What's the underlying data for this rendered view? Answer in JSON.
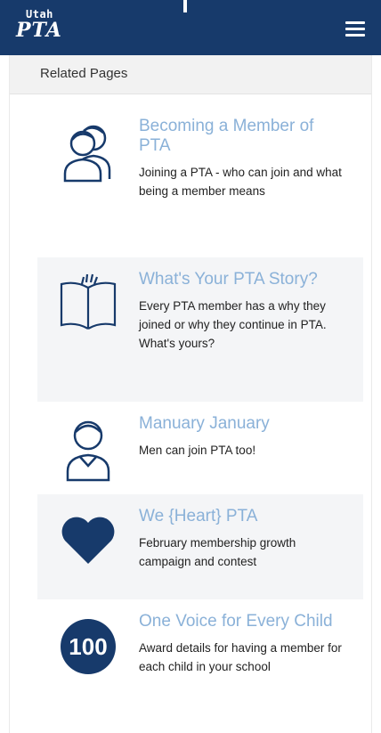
{
  "header": {
    "logo_top": "Utah",
    "logo_main": "PTA",
    "menu_icon": "hamburger-menu-icon"
  },
  "section": {
    "title": "Related Pages"
  },
  "items": [
    {
      "icon": "two-people-icon",
      "title": "Becoming a Member of PTA",
      "desc": "Joining a PTA - who can join and what being a member means"
    },
    {
      "icon": "open-book-icon",
      "title": "What's Your PTA Story?",
      "desc": "Every PTA member has a why they joined or why they continue in PTA. What's yours?"
    },
    {
      "icon": "person-icon",
      "title": "Manuary January",
      "desc": "Men can join PTA too!"
    },
    {
      "icon": "heart-icon",
      "title": "We {Heart} PTA",
      "desc": "February membership growth campaign and contest"
    },
    {
      "icon": "badge-100-icon",
      "badge_text": "100",
      "title": "One Voice for Every Child",
      "desc": "Award details for having a member for each child in your school"
    }
  ],
  "colors": {
    "brand": "#173a6b",
    "link": "#8ab1d8"
  }
}
